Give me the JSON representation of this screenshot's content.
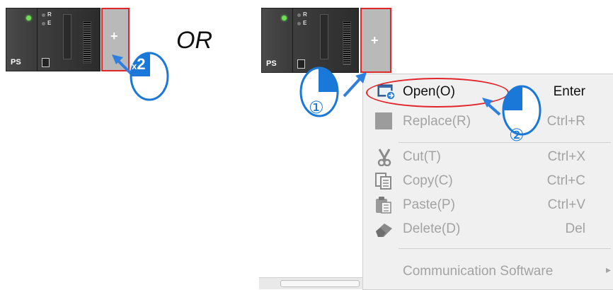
{
  "left_rack": {
    "ps_label": "PS",
    "cpu_leds": [
      "R",
      "E"
    ],
    "add_slot_symbol": "+"
  },
  "or_label": "OR",
  "double_click_badge": {
    "prefix": "x",
    "count": "2"
  },
  "right_rack": {
    "ps_label": "PS",
    "cpu_leds": [
      "R",
      "E"
    ],
    "add_slot_symbol": "+"
  },
  "context_menu": {
    "items": [
      {
        "label": "Open(O)",
        "shortcut": "Enter",
        "enabled": true,
        "icon": "open-window-icon"
      },
      {
        "label": "Replace(R)",
        "shortcut": "Ctrl+R",
        "enabled": false,
        "icon": "replace-icon"
      },
      {
        "label": "Cut(T)",
        "shortcut": "Ctrl+X",
        "enabled": false,
        "icon": "scissors-icon"
      },
      {
        "label": "Copy(C)",
        "shortcut": "Ctrl+C",
        "enabled": false,
        "icon": "copy-icon"
      },
      {
        "label": "Paste(P)",
        "shortcut": "Ctrl+V",
        "enabled": false,
        "icon": "paste-icon"
      },
      {
        "label": "Delete(D)",
        "shortcut": "Del",
        "enabled": false,
        "icon": "eraser-icon"
      },
      {
        "label": "Communication Software",
        "shortcut": "▸",
        "enabled": false,
        "icon": ""
      }
    ]
  },
  "step_markers": [
    "①",
    "②"
  ],
  "colors": {
    "highlight_red": "#e0262b",
    "mouse_blue": "#1a78d8",
    "arrow_blue": "#2f7fe0",
    "disabled_text": "#a3a3a3"
  }
}
